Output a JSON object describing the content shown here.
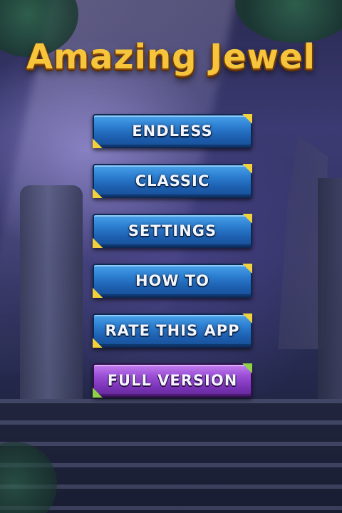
{
  "game": {
    "title": "Amazing Jewel"
  },
  "menu": {
    "items": [
      {
        "label": "ENDLESS"
      },
      {
        "label": "CLASSIC"
      },
      {
        "label": "SETTINGS"
      },
      {
        "label": "HOW TO"
      },
      {
        "label": "RATE THIS APP"
      },
      {
        "label": "FULL VERSION"
      }
    ]
  },
  "colors": {
    "button_blue": "#2c7fd1",
    "button_purple": "#9b4fd6",
    "corner_gold": "#f3d13a",
    "corner_green": "#8ed147",
    "title_gold": "#f6c53c"
  }
}
